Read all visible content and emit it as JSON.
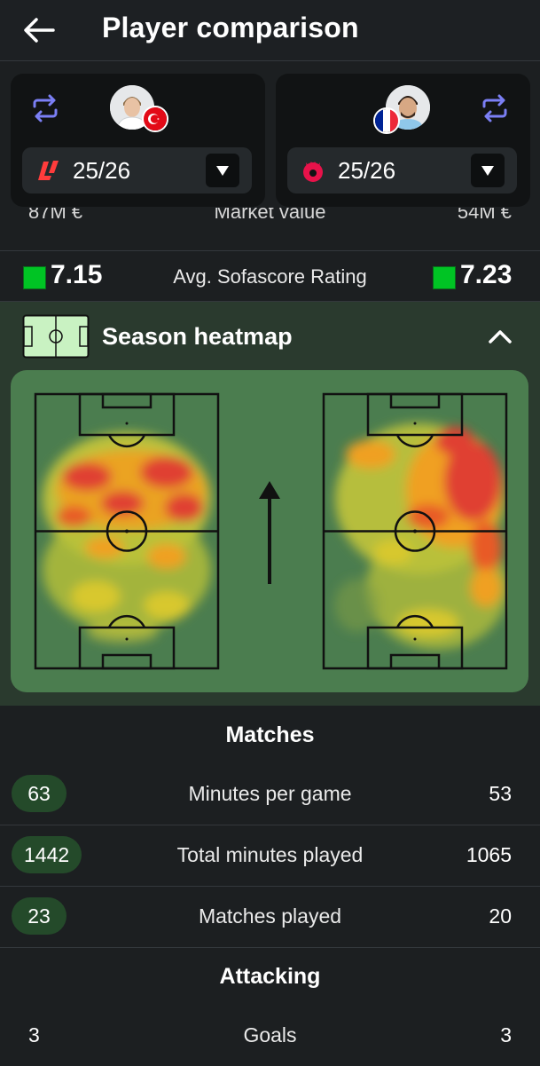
{
  "header": {
    "title": "Player comparison"
  },
  "player_left": {
    "season": "25/26",
    "league_icon": "laliga-logo",
    "flag": "turkey-flag"
  },
  "player_right": {
    "season": "25/26",
    "league_icon": "premier-league-logo",
    "flag": "france-flag"
  },
  "market_value": {
    "label": "Market value",
    "left": "87M €",
    "right": "54M €"
  },
  "rating": {
    "label": "Avg. Sofascore Rating",
    "left": "7.15",
    "right": "7.23"
  },
  "heatmap": {
    "title": "Season heatmap"
  },
  "matches": {
    "title": "Matches",
    "rows": [
      {
        "label": "Minutes per game",
        "left": "63",
        "right": "53"
      },
      {
        "label": "Total minutes played",
        "left": "1442",
        "right": "1065"
      },
      {
        "label": "Matches played",
        "left": "23",
        "right": "20"
      }
    ]
  },
  "attacking": {
    "title": "Attacking",
    "rows": [
      {
        "label": "Goals",
        "left": "3",
        "right": "3"
      }
    ]
  },
  "colors": {
    "background": "#1c1f21",
    "card": "#111314",
    "accent_green": "#00c424",
    "pill_green": "#244a2a",
    "heat_panel": "#4b7d4f",
    "swap_icon": "#7b7ff5"
  }
}
